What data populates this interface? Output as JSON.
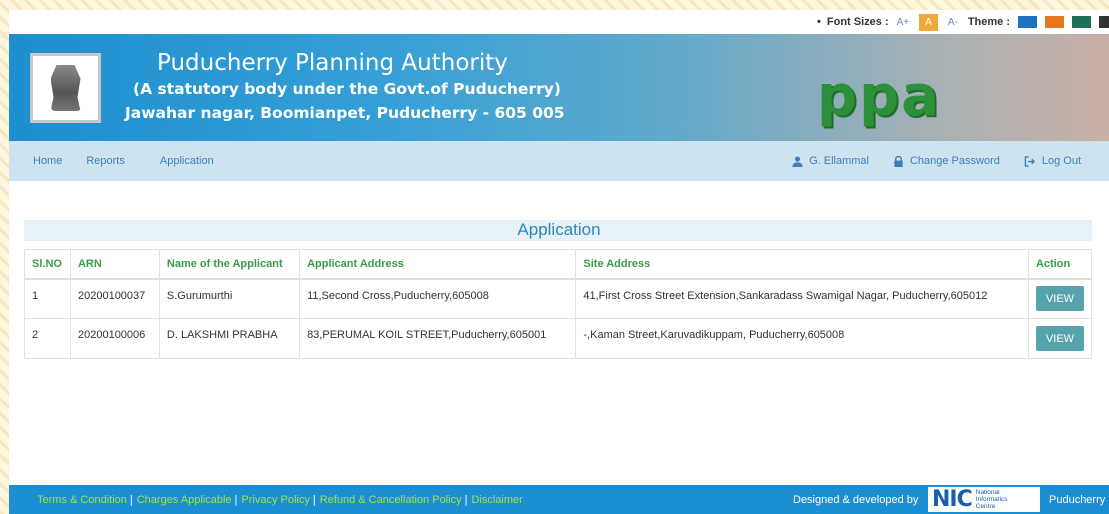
{
  "topbar": {
    "font_sizes_label": "Font Sizes :",
    "font_increase": "A+",
    "font_normal": "A",
    "font_decrease": "A-",
    "theme_label": "Theme :",
    "theme_colors": [
      "#1e73be",
      "#e8761c",
      "#1f6f5c",
      "#333333"
    ]
  },
  "header": {
    "title": "Puducherry Planning Authority",
    "subtitle": "(A statutory body under the Govt.of Puducherry)",
    "address": "Jawahar nagar, Boomianpet, Puducherry - 605 005",
    "logo_text": "ppa"
  },
  "nav": {
    "home": "Home",
    "reports": "Reports",
    "application": "Application",
    "user": "G. Ellammal",
    "change_password": "Change Password",
    "logout": "Log Out"
  },
  "main": {
    "section_title": "Application",
    "columns": [
      "Sl.NO",
      "ARN",
      "Name of the Applicant",
      "Applicant Address",
      "Site Address",
      "Action"
    ],
    "rows": [
      {
        "slno": "1",
        "arn": "20200100037",
        "name": "S.Gurumurthi",
        "applicant_address": "11,Second Cross,Puducherry,605008",
        "site_address": "41,First Cross Street Extension,Sankaradass Swamigal Nagar, Puducherry,605012",
        "action": "VIEW"
      },
      {
        "slno": "2",
        "arn": "20200100006",
        "name": "D. LAKSHMI PRABHA",
        "applicant_address": "83,PERUMAL KOIL STREET,Puducherry,605001",
        "site_address": "-,Kaman Street,Karuvadikuppam, Puducherry,605008",
        "action": "VIEW"
      }
    ]
  },
  "footer": {
    "links": [
      "Terms & Condition",
      "Charges Applicable",
      "Privacy Policy",
      "Refund & Cancellation Policy",
      "Disclaimer"
    ],
    "separator": "|",
    "designed_by": "Designed & developed by",
    "nic_mark": "NIC",
    "nic_line1": "National",
    "nic_line2": "Informatics",
    "nic_line3": "Centre",
    "region": "Puducherry"
  }
}
